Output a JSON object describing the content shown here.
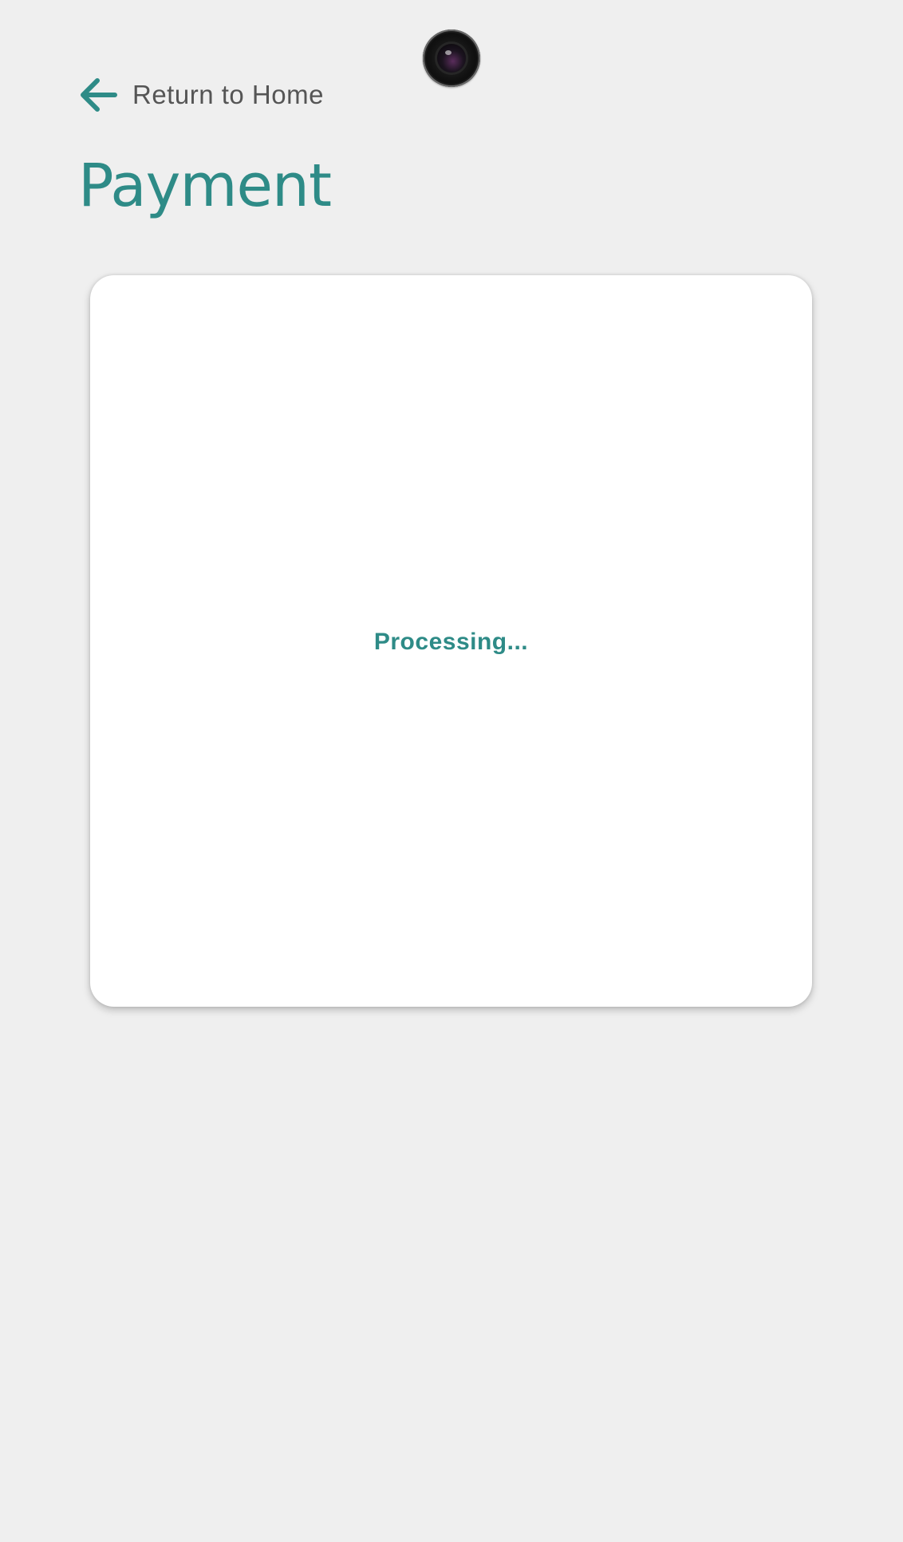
{
  "header": {
    "back_link_label": "Return to Home",
    "back_icon": "arrow-left-icon",
    "camera_icon": "front-camera-icon"
  },
  "page": {
    "title": "Payment"
  },
  "card": {
    "status_text": "Processing..."
  },
  "colors": {
    "accent": "#2e8b87",
    "background": "#efefef",
    "card_background": "#ffffff",
    "link_text": "#555555"
  }
}
